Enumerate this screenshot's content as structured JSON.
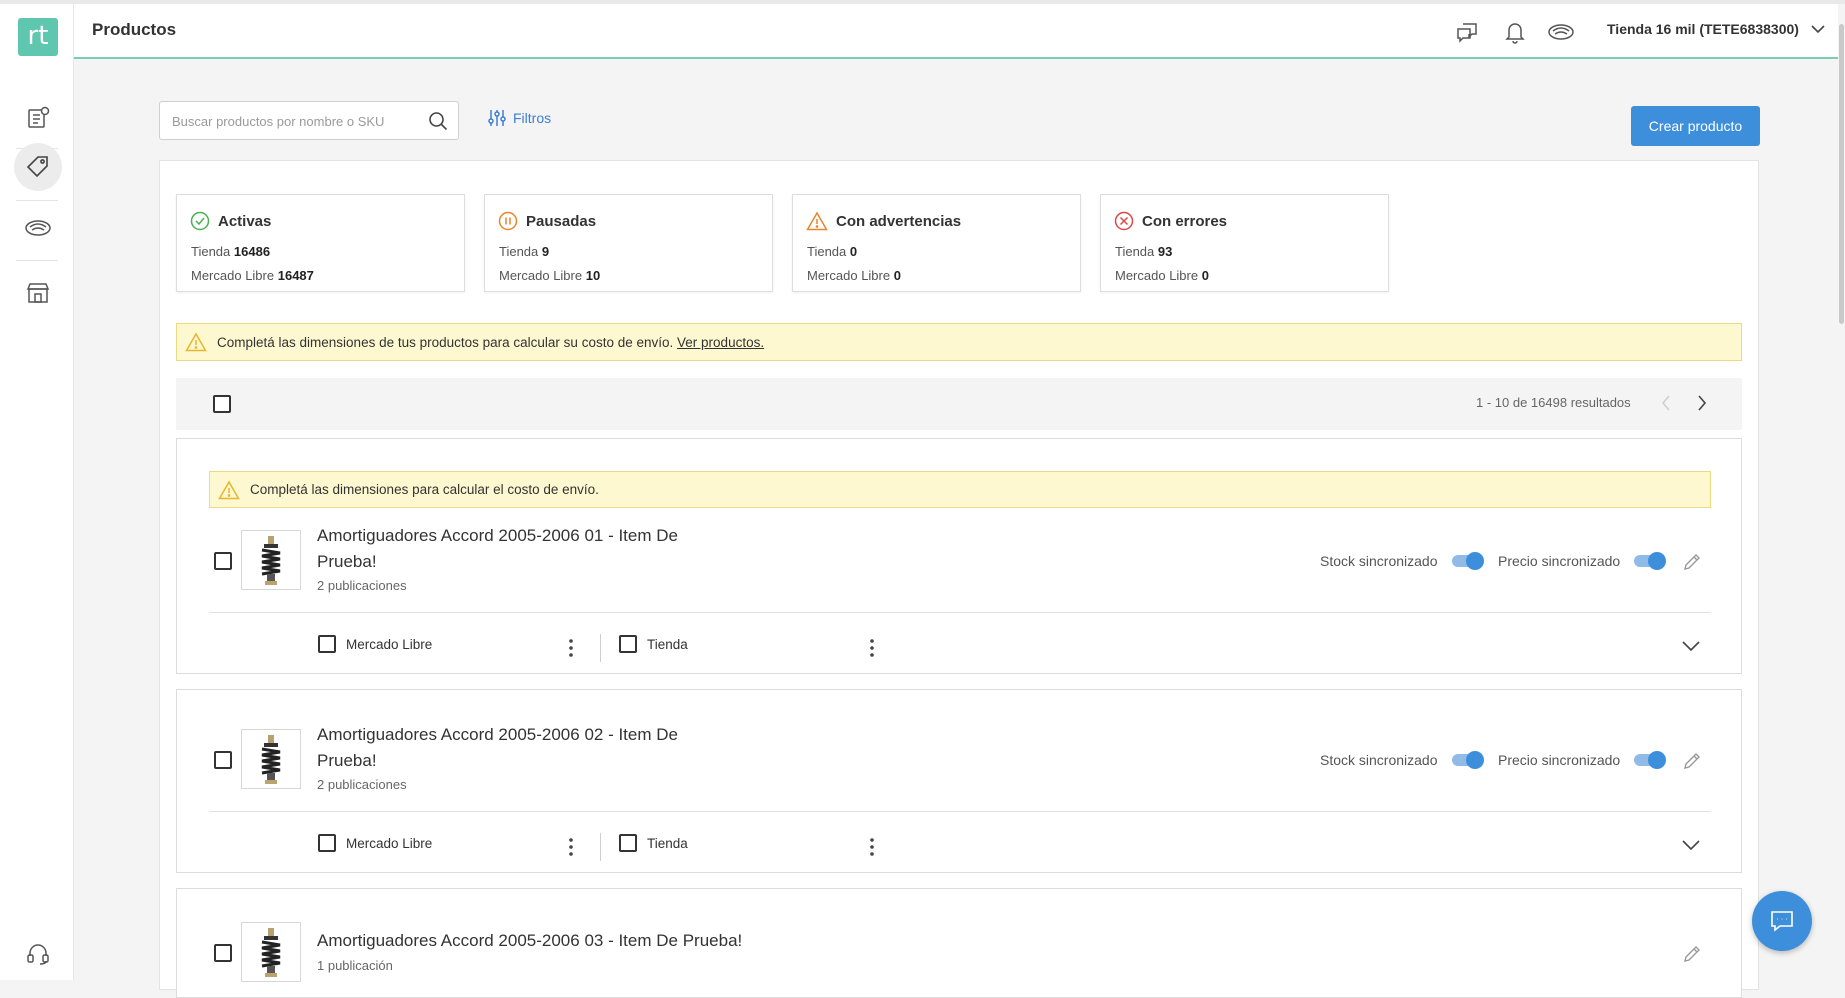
{
  "app": {
    "logo_text": "rt"
  },
  "sidebar": {
    "items": [
      {
        "icon": "orders-icon"
      },
      {
        "icon": "tag-icon",
        "active": true
      },
      {
        "icon": "shipping-icon"
      },
      {
        "icon": "store-icon"
      },
      {
        "icon": "headset-icon"
      }
    ]
  },
  "header": {
    "title": "Productos",
    "store_label": "Tienda 16 mil (TETE6838300)"
  },
  "toolbar": {
    "search_placeholder": "Buscar productos por nombre o SKU",
    "filters_label": "Filtros",
    "create_label": "Crear producto"
  },
  "stats": [
    {
      "title": "Activas",
      "store_label": "Tienda",
      "store_value": "16486",
      "ml_label": "Mercado Libre",
      "ml_value": "16487",
      "color": "#4caf50"
    },
    {
      "title": "Pausadas",
      "store_label": "Tienda",
      "store_value": "9",
      "ml_label": "Mercado Libre",
      "ml_value": "10",
      "color": "#e8862a"
    },
    {
      "title": "Con advertencias",
      "store_label": "Tienda",
      "store_value": "0",
      "ml_label": "Mercado Libre",
      "ml_value": "0",
      "color": "#e8862a"
    },
    {
      "title": "Con errores",
      "store_label": "Tienda",
      "store_value": "93",
      "ml_label": "Mercado Libre",
      "ml_value": "0",
      "color": "#e04848"
    }
  ],
  "notice": {
    "text": "Completá las dimensiones de tus productos para calcular su costo de envío.",
    "link": "Ver productos."
  },
  "pagination": {
    "text": "1 - 10 de 16498 resultados"
  },
  "products": [
    {
      "warning": "Completá las dimensiones para calcular el costo de envío.",
      "title_line1": "Amortiguadores Accord 2005-2006 01 - Item De",
      "title_line2": "Prueba!",
      "subtitle": "2 publicaciones",
      "stock_label": "Stock sincronizado",
      "price_label": "Precio sincronizado",
      "channel_ml": "Mercado Libre",
      "channel_store": "Tienda"
    },
    {
      "title_line1": "Amortiguadores Accord 2005-2006 02 - Item De",
      "title_line2": "Prueba!",
      "subtitle": "2 publicaciones",
      "stock_label": "Stock sincronizado",
      "price_label": "Precio sincronizado",
      "channel_ml": "Mercado Libre",
      "channel_store": "Tienda"
    },
    {
      "title_line1": "Amortiguadores Accord 2005-2006 03 - Item De Prueba!",
      "subtitle": "1 publicación"
    }
  ]
}
